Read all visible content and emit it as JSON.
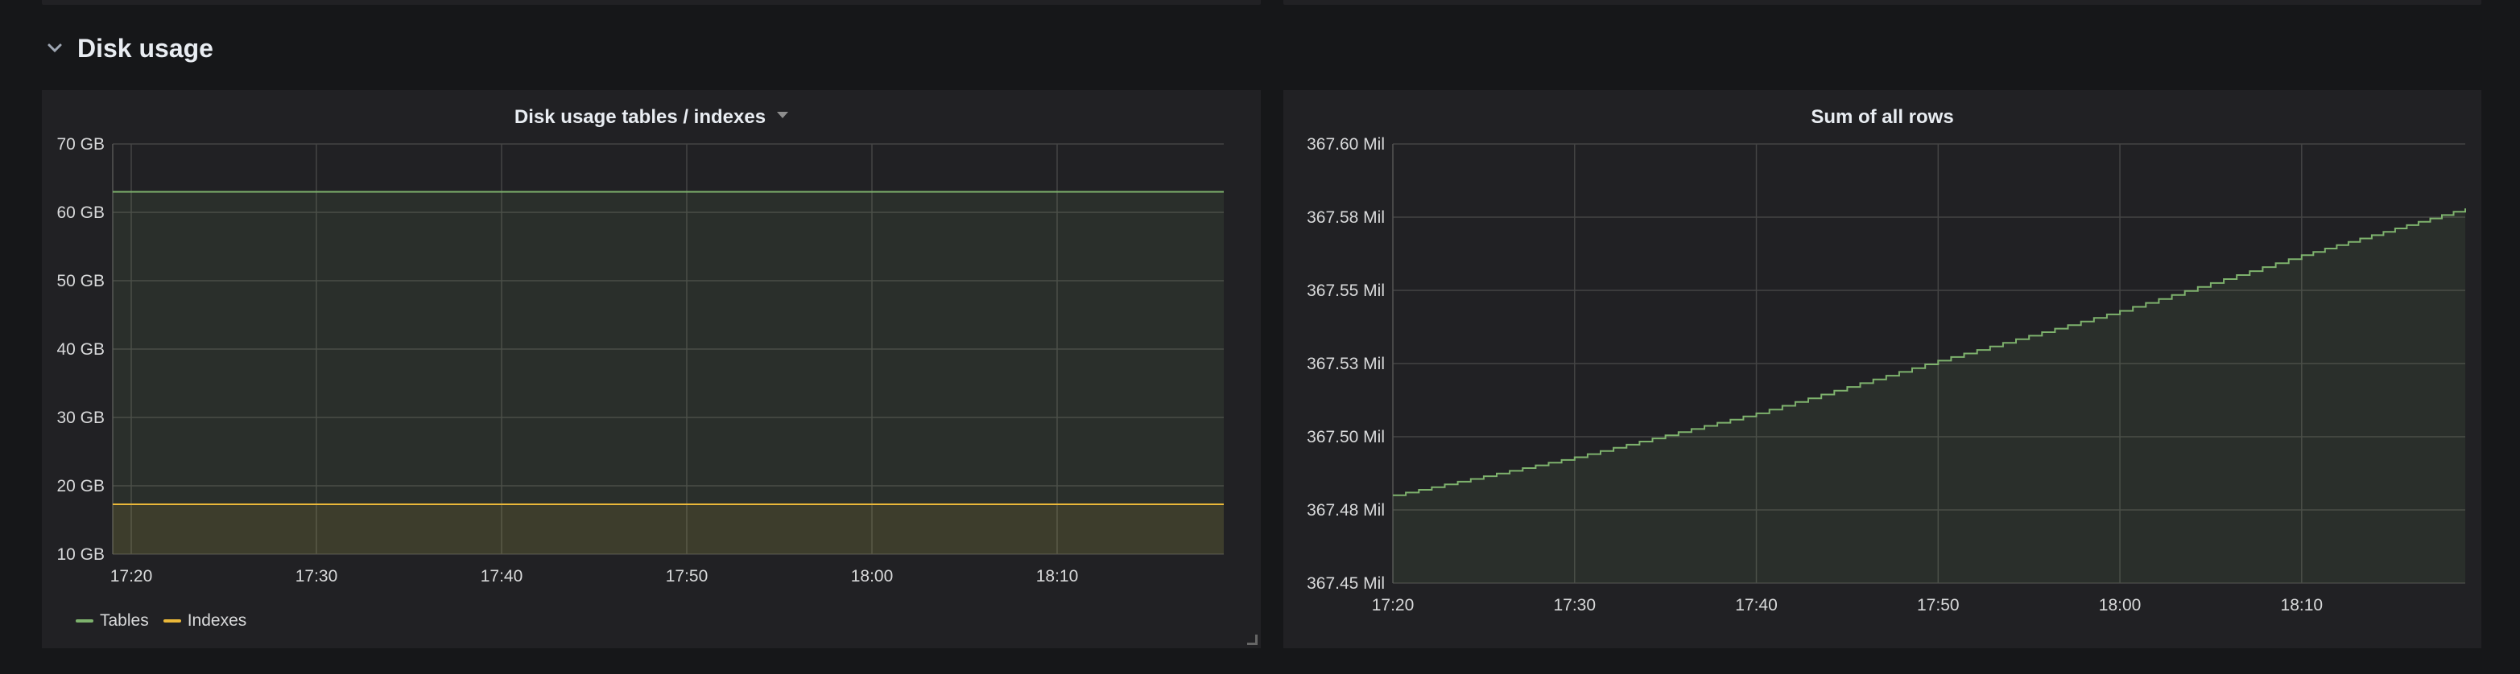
{
  "colors": {
    "tables": "#7eb26d",
    "indexes": "#eab839",
    "rows": "#7eb26d"
  },
  "row": {
    "title": "Disk usage",
    "icon": "chevron-down-icon"
  },
  "panels": {
    "disk": {
      "title": "Disk usage tables / indexes",
      "legend": [
        {
          "name": "Tables"
        },
        {
          "name": "Indexes"
        }
      ]
    },
    "rows": {
      "title": "Sum of all rows"
    }
  },
  "chart_data": [
    {
      "type": "area",
      "title": "Disk usage tables / indexes",
      "x_ticks": [
        "17:20",
        "17:30",
        "17:40",
        "17:50",
        "18:00",
        "18:10"
      ],
      "x_range": [
        "17:19",
        "18:19"
      ],
      "y_ticks": [
        "10 GB",
        "20 GB",
        "30 GB",
        "40 GB",
        "50 GB",
        "60 GB",
        "70 GB"
      ],
      "ylim": [
        10,
        70
      ],
      "y_unit": "GB",
      "grid": true,
      "legend_position": "bottom-left",
      "series": [
        {
          "name": "Tables",
          "x": [
            "17:19",
            "18:19"
          ],
          "values": [
            63,
            63
          ]
        },
        {
          "name": "Indexes",
          "x": [
            "17:19",
            "18:19"
          ],
          "values": [
            17.3,
            17.3
          ]
        }
      ]
    },
    {
      "type": "area",
      "title": "Sum of all rows",
      "x_ticks": [
        "17:20",
        "17:30",
        "17:40",
        "17:50",
        "18:00",
        "18:10"
      ],
      "x_range": [
        "17:20",
        "18:19"
      ],
      "y_ticks": [
        "367.45 Mil",
        "367.48 Mil",
        "367.50 Mil",
        "367.53 Mil",
        "367.55 Mil",
        "367.58 Mil",
        "367.60 Mil"
      ],
      "ylim": [
        367.45,
        367.6
      ],
      "y_unit": "Mil",
      "grid": true,
      "series": [
        {
          "x": [
            "17:20",
            "17:30",
            "17:40",
            "17:50",
            "18:00",
            "18:10",
            "18:19"
          ],
          "values": [
            367.48,
            367.493,
            367.508,
            367.526,
            367.543,
            367.562,
            367.578
          ]
        }
      ]
    }
  ]
}
